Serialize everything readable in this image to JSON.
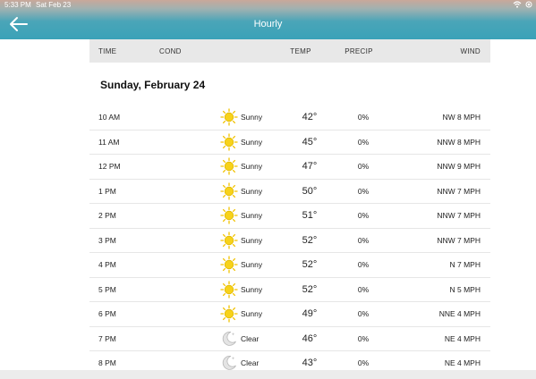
{
  "status_bar": {
    "time": "5:33 PM",
    "date": "Sat Feb 23"
  },
  "header": {
    "title": "Hourly",
    "back_icon": "arrow-left-icon"
  },
  "columns": {
    "time": "TIME",
    "cond": "COND",
    "temp": "TEMP",
    "precip": "PRECIP",
    "wind": "WIND"
  },
  "day": "Sunday, February 24",
  "rows": [
    {
      "time": "10 AM",
      "icon": "sun-icon",
      "cond": "Sunny",
      "temp": "42°",
      "precip": "0%",
      "wind": "NW 8 MPH"
    },
    {
      "time": "11 AM",
      "icon": "sun-icon",
      "cond": "Sunny",
      "temp": "45°",
      "precip": "0%",
      "wind": "NNW 8 MPH"
    },
    {
      "time": "12 PM",
      "icon": "sun-icon",
      "cond": "Sunny",
      "temp": "47°",
      "precip": "0%",
      "wind": "NNW 9 MPH"
    },
    {
      "time": "1 PM",
      "icon": "sun-icon",
      "cond": "Sunny",
      "temp": "50°",
      "precip": "0%",
      "wind": "NNW 7 MPH"
    },
    {
      "time": "2 PM",
      "icon": "sun-icon",
      "cond": "Sunny",
      "temp": "51°",
      "precip": "0%",
      "wind": "NNW 7 MPH"
    },
    {
      "time": "3 PM",
      "icon": "sun-icon",
      "cond": "Sunny",
      "temp": "52°",
      "precip": "0%",
      "wind": "NNW 7 MPH"
    },
    {
      "time": "4 PM",
      "icon": "sun-icon",
      "cond": "Sunny",
      "temp": "52°",
      "precip": "0%",
      "wind": "N 7 MPH"
    },
    {
      "time": "5 PM",
      "icon": "sun-icon",
      "cond": "Sunny",
      "temp": "52°",
      "precip": "0%",
      "wind": "N 5 MPH"
    },
    {
      "time": "6 PM",
      "icon": "sun-icon",
      "cond": "Sunny",
      "temp": "49°",
      "precip": "0%",
      "wind": "NNE 4 MPH"
    },
    {
      "time": "7 PM",
      "icon": "moon-icon",
      "cond": "Clear",
      "temp": "46°",
      "precip": "0%",
      "wind": "NE 4 MPH"
    },
    {
      "time": "8 PM",
      "icon": "moon-icon",
      "cond": "Clear",
      "temp": "43°",
      "precip": "0%",
      "wind": "NE 4 MPH"
    }
  ]
}
